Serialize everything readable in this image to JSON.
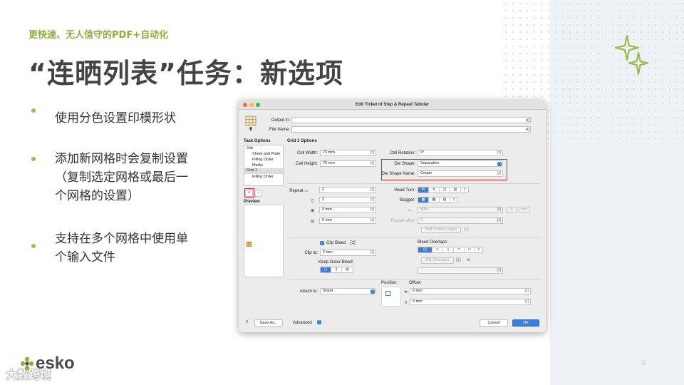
{
  "slide": {
    "subtitle": "更快速、无人值守的PDF+自动化",
    "title": "“连晒列表”任务：新选项",
    "bullets": [
      "使用分色设置印模形状",
      "添加新网格时会复制设置（复制选定网格或最后一个网格的设置）",
      "支持在多个网格中使用单个输入文件"
    ],
    "logo_text": "esko",
    "watermark": "大数跨境",
    "page_number": "3"
  },
  "colors": {
    "accent_green": "#8db13c",
    "title_gray": "#444444",
    "mac_blue": "#3b7ddd",
    "highlight_red": "#d8262a"
  },
  "dialog": {
    "title": "Edit Ticket of Step & Repeat Tabular",
    "output_in_label": "Output in:",
    "file_name_label": "File Name:",
    "task_options_label": "Task Options",
    "task_tree": [
      "Job",
      "Sheet and Plate",
      "Filling Order",
      "Marks",
      "Grid 1",
      "Filling Order"
    ],
    "add_button": "+",
    "remove_button": "−",
    "preview_label": "Preview",
    "preview_cell": "1",
    "grid_options_header": "Grid 1 Options",
    "cell_width_label": "Cell Width:",
    "cell_width_value": "73 mm",
    "cell_height_label": "Cell Height:",
    "cell_height_value": "70 mm",
    "cell_rotation_label": "Cell Rotation:",
    "cell_rotation_value": "0°",
    "die_shape_label": "Die Shape:",
    "die_shape_value": "Separation",
    "die_shape_name_label": "Die Shape Name:",
    "die_shape_name_value": "Coupe",
    "repeat_label": "Repeat",
    "repeat_x": "2",
    "repeat_y": "2",
    "gap_x": "0 mm",
    "gap_y": "0 mm",
    "head_turn_label": "Head Turn:",
    "stagger_label": "Stagger:",
    "stagger_value": "50%",
    "restart_after_label": "Restart after:",
    "restart_after_value": "2",
    "add_partial_labels": "Add Partial Labels",
    "clip_bleed_label": "Clip Bleed",
    "clip_at_label": "Clip at:",
    "clip_at_value": "2 mm",
    "keep_outer_bleed_label": "Keep Outer Bleed:",
    "bleed_overlaps_label": "Bleed Overlaps:",
    "clip_overlaps_button": "Clip Overlaps",
    "clip_overlaps_at": "at",
    "attach_to_label": "Attach to:",
    "attach_to_value": "Sheet",
    "position_label": "Position:",
    "offset_label": "Offset:",
    "offset_x": "0 mm",
    "offset_y": "0 mm",
    "help_button": "?",
    "save_as_button": "Save As...",
    "advanced_label": "Advanced",
    "cancel_button": "Cancel",
    "ok_button": "OK"
  }
}
